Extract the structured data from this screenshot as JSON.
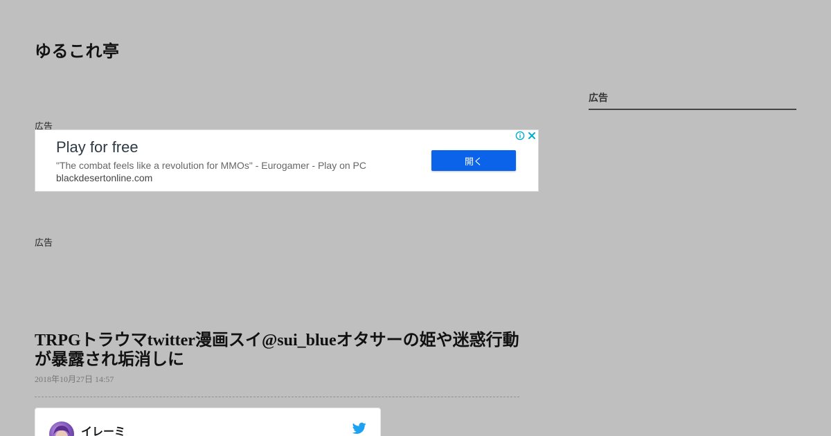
{
  "site": {
    "title": "ゆるこれ亭"
  },
  "ads": {
    "label_top": "広告",
    "label_second": "広告",
    "banner": {
      "headline": "Play for free",
      "description": "\"The combat feels like a revolution for MMOs\" - Eurogamer - Play on PC",
      "domain": "blackdesertonline.com",
      "cta_label": "開く",
      "icons": [
        "adchoices-info-icon",
        "close-icon"
      ]
    }
  },
  "article": {
    "title": "TRPGトラウマtwitter漫画スイ@sui_blueオタサーの姫や迷惑行動が暴露され垢消しに",
    "date": "2018年10月27日 14:57"
  },
  "tweet": {
    "author_name": "イレーミ",
    "icon": "twitter-bird-icon"
  },
  "sidebar": {
    "heading": "広告"
  },
  "colors": {
    "background": "#bfbfbf",
    "cta": "#0a63e9",
    "twitter": "#1da1f2"
  }
}
